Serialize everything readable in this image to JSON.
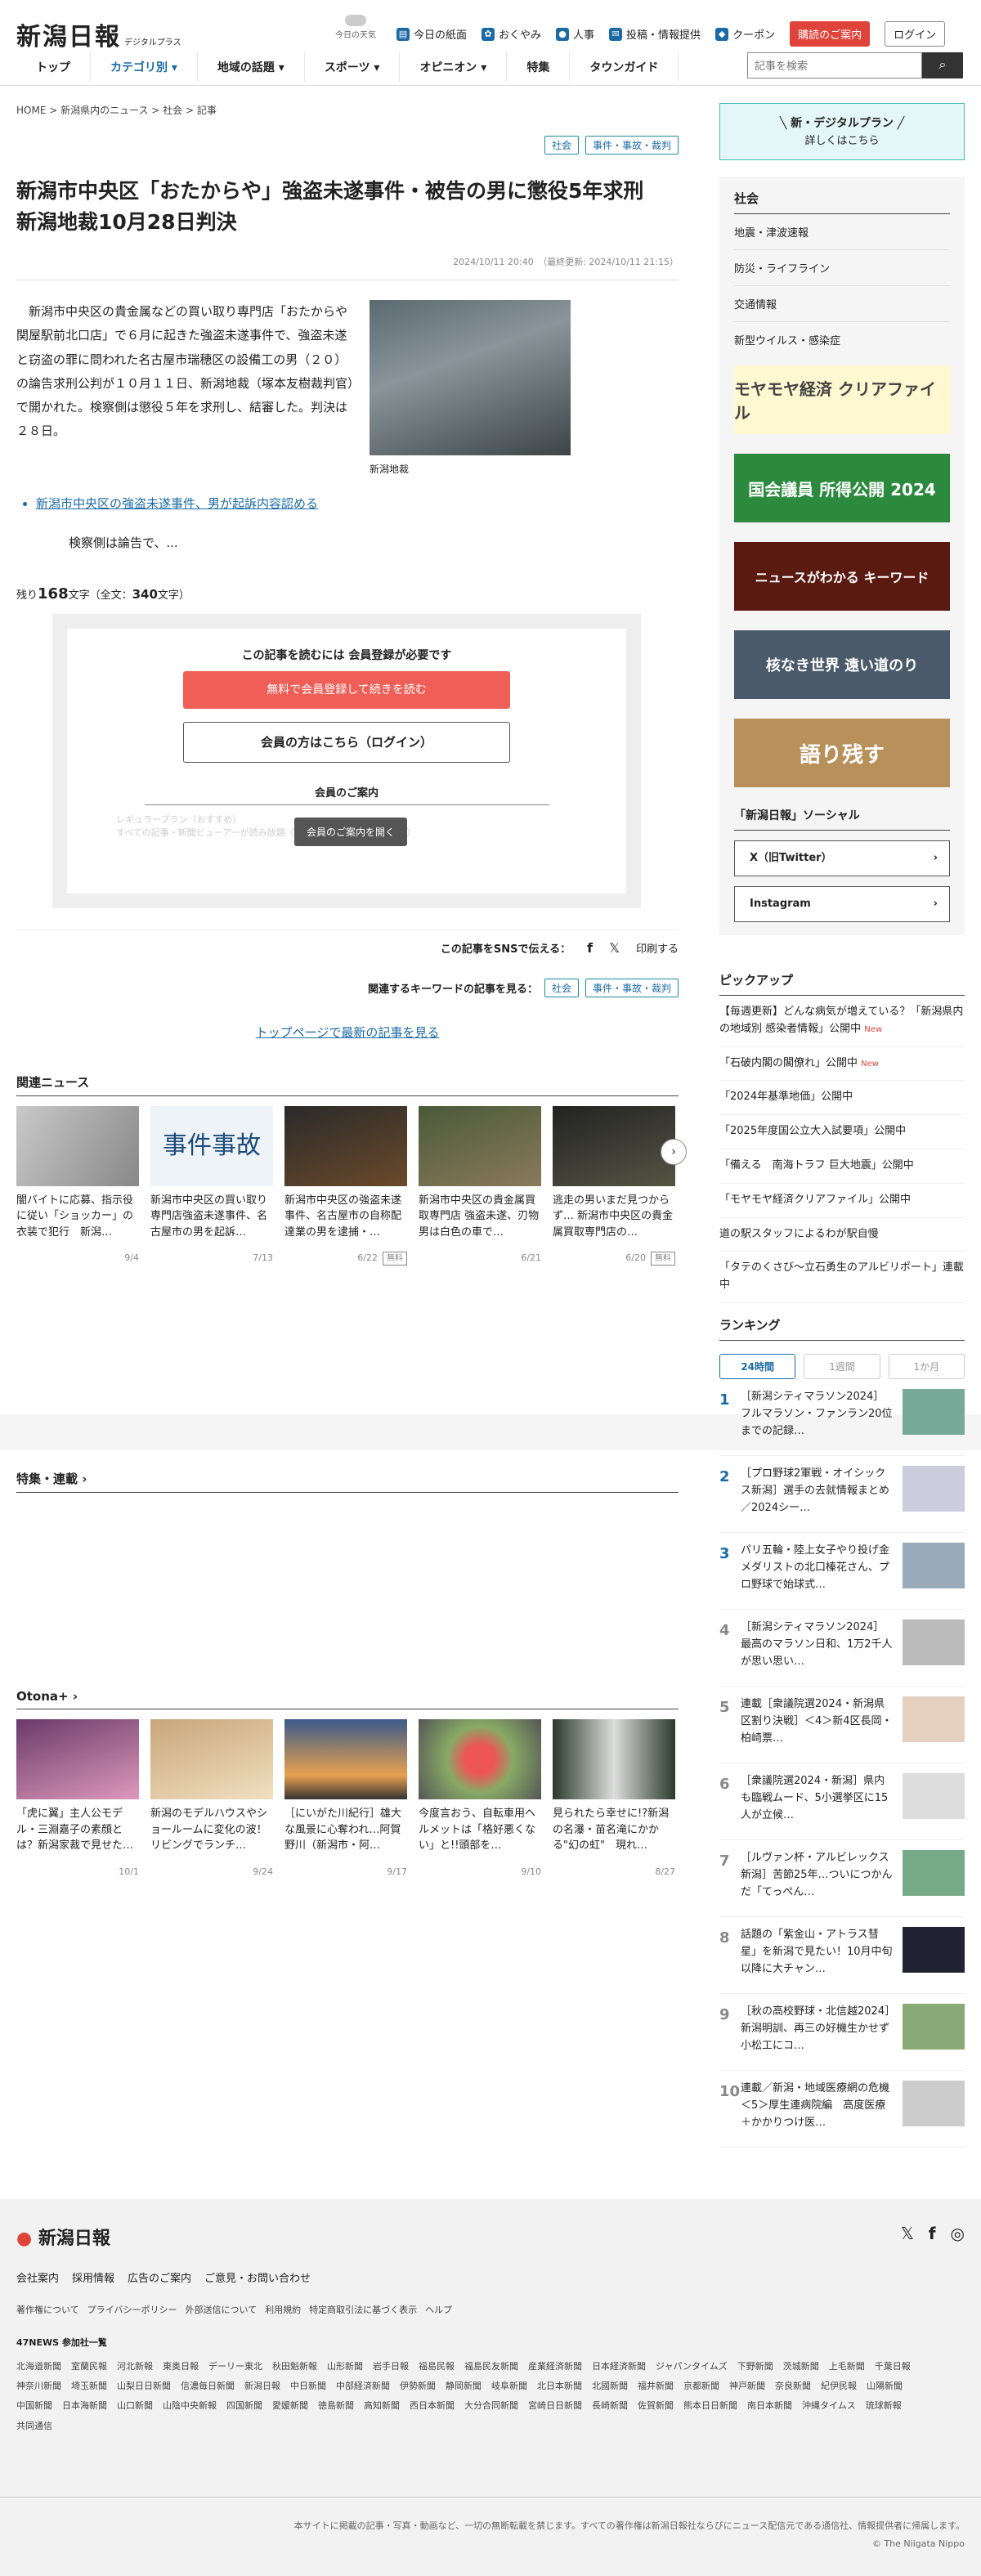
{
  "header": {
    "logo": "新潟日報",
    "logo_sub": "デジタルプラス",
    "weather": "今日の天気",
    "links": [
      "今日の紙面",
      "おくやみ",
      "人事",
      "投稿・情報提供",
      "クーポン"
    ],
    "subscribe": "購読のご案内",
    "login": "ログイン",
    "nav": [
      "トップ",
      "カテゴリ別 ▾",
      "地域の話題 ▾",
      "スポーツ ▾",
      "オピニオン ▾",
      "特集",
      "タウンガイド"
    ],
    "search_placeholder": "記事を検索"
  },
  "article": {
    "breadcrumb": "HOME > 新潟県内のニュース > 社会 > 記事",
    "tags": [
      "社会",
      "事件・事故・裁判"
    ],
    "title": "新潟市中央区「おたからや」強盗未遂事件・被告の男に懲役5年求刑　新潟地裁10月28日判決",
    "dates": "2024/10/11 20:40　（最終更新: 2024/10/11 21:15）",
    "body": "新潟市中央区の貴金属などの買い取り専門店「おたからや関屋駅前北口店」で６月に起きた強盗未遂事件で、強盗未遂と窃盗の罪に問われた名古屋市瑞穂区の設備工の男（２０）の論告求刑公判が１０月１１日、新潟地裁（塚本友樹裁判官）で開かれた。検察側は懲役５年を求刑し、結審した。判決は２８日。",
    "photo_caption": "新潟地裁",
    "related": "新潟市中央区の強盗未遂事件、男が起訴内容認める",
    "cont": "検察側は論告で、...",
    "remain_pre": "残り",
    "remain_num": "168",
    "remain_mid": "文字（全文：",
    "remain_total": "340",
    "remain_post": "文字）"
  },
  "paywall": {
    "title": "この記事を読むには 会員登録が必要です",
    "register": "無料で会員登録して続きを読む",
    "login": "会員の方はこちら（ログイン）",
    "guide": "会員のご案内",
    "regular": "レギュラープラン（おすすめ）",
    "all": "すべての記事・新聞ビューアーが読み放題（1日分は約400記事あります）",
    "open": "会員のご案内を開く"
  },
  "share": {
    "label": "この記事をSNSで伝える：",
    "print": "印刷する",
    "kw_label": "関連するキーワードの記事を見る：",
    "top": "トップページで最新の記事を見る"
  },
  "related_news": {
    "title": "関連ニュース",
    "items": [
      {
        "text": "闇バイトに応募、指示役に従い「ショッカー」の衣装で犯行　新潟…",
        "date": "9/4",
        "free": ""
      },
      {
        "text": "新潟市中央区の買い取り専門店強盗未遂事件、名古屋市の男を起訴…",
        "date": "7/13",
        "free": ""
      },
      {
        "text": "新潟市中央区の強盗未遂事件、名古屋市の自称配達業の男を逮捕・…",
        "date": "6/22",
        "free": "無料"
      },
      {
        "text": "新潟市中央区の貴金属買取専門店 強盗未遂、刃物男は白色の車で…",
        "date": "6/21",
        "free": ""
      },
      {
        "text": "逃走の男いまだ見つからず… 新潟市中央区の貴金属買取専門店の…",
        "date": "6/20",
        "free": "無料"
      }
    ]
  },
  "feature_title": "特集・連載",
  "otona": {
    "title": "Otona+",
    "items": [
      {
        "text": "「虎に翼」主人公モデル・三淵嘉子の素顔とは？新潟家裁で見せた…",
        "date": "10/1"
      },
      {
        "text": "新潟のモデルハウスやショールームに変化の波！リビングでランチ…",
        "date": "9/24"
      },
      {
        "text": "［にいがた川紀行］雄大な風景に心奪われ…阿賀野川（新潟市・阿…",
        "date": "9/17"
      },
      {
        "text": "今度言おう、自転車用ヘルメットは「格好悪くない」と!!頭部を…",
        "date": "9/10"
      },
      {
        "text": "見られたら幸せに!?新潟の名瀑・苗名滝にかかる\"幻の虹\"　現れ…",
        "date": "8/27"
      }
    ]
  },
  "sidebar": {
    "banner_title": "╲ 新・デジタルプラン ╱",
    "banner_sub": "詳しくはこちら",
    "cat_title": "社会",
    "cat_links": [
      "地震・津波速報",
      "防災・ライフライン",
      "交通情報",
      "新型ウイルス・感染症"
    ],
    "ads": [
      "モヤモヤ経済 クリアファイル",
      "国会議員 所得公開 2024",
      "ニュースがわかる キーワード",
      "核なき世界 遠い道のり",
      "語り残す"
    ],
    "social_title": "「新潟日報」ソーシャル",
    "social": [
      "X（旧Twitter）",
      "Instagram"
    ],
    "pickup_title": "ピックアップ",
    "new": "New",
    "pickup": [
      {
        "t": "【毎週更新】どんな病気が増えている？「新潟県内の地域別 感染者情報」公開中",
        "n": true
      },
      {
        "t": "「石破内閣の閣僚れ」公開中",
        "n": true
      },
      {
        "t": "「2024年基準地価」公開中",
        "n": false
      },
      {
        "t": "「2025年度国公立大入試要項」公開中",
        "n": false
      },
      {
        "t": "「備える　南海トラフ 巨大地震」公開中",
        "n": false
      },
      {
        "t": "「モヤモヤ経済クリアファイル」公開中",
        "n": false
      },
      {
        "t": "道の駅スタッフによるわが駅自慢",
        "n": false
      },
      {
        "t": "「タテのくさび〜立石勇生のアルビリポート」連載中",
        "n": false
      }
    ],
    "ranking_title": "ランキング",
    "ranking_tabs": [
      "24時間",
      "1週間",
      "1か月"
    ],
    "ranking": [
      {
        "n": "1",
        "t": "［新潟シティマラソン2024］フルマラソン・ファンラン20位までの記録…"
      },
      {
        "n": "2",
        "t": "［プロ野球2軍戦・オイシックス新潟］選手の去就情報まとめ／2024シー…"
      },
      {
        "n": "3",
        "t": "パリ五輪・陸上女子やり投げ金メダリストの北口榛花さん、プロ野球で始球式…"
      },
      {
        "n": "4",
        "t": "［新潟シティマラソン2024］最高のマラソン日和、1万2千人が思い思い…"
      },
      {
        "n": "5",
        "t": "連載［衆議院選2024・新潟県区割り決戦］＜4＞新4区長岡・柏崎票…"
      },
      {
        "n": "6",
        "t": "［衆議院選2024・新潟］県内も臨戦ムード、5小選挙区に15人が立候…"
      },
      {
        "n": "7",
        "t": "［ルヴァン杯・アルビレックス新潟］苦節25年…ついにつかんだ「てっぺん…"
      },
      {
        "n": "8",
        "t": "話題の「紫金山・アトラス彗星」を新潟で見たい！10月中旬以降に大チャン…"
      },
      {
        "n": "9",
        "t": "［秋の高校野球・北信越2024］新潟明訓、再三の好機生かせず小松工にコ…"
      },
      {
        "n": "10",
        "t": "連載／新潟・地域医療網の危機＜5＞厚生連病院編　高度医療＋かかりつけ医…"
      }
    ]
  },
  "footer": {
    "logo": "新潟日報",
    "links1": [
      "会社案内",
      "採用情報",
      "広告のご案内",
      "ご意見・お問い合わせ"
    ],
    "links2": [
      "著作権について",
      "プライバシーポリシー",
      "外部送信について",
      "利用規約",
      "特定商取引法に基づく表示",
      "ヘルプ"
    ],
    "np_title": "47NEWS 参加社一覧",
    "papers": [
      "北海道新聞",
      "室蘭民報",
      "河北新報",
      "東奥日報",
      "デーリー東北",
      "秋田魁新報",
      "山形新聞",
      "岩手日報",
      "福島民報",
      "福島民友新聞",
      "産業経済新聞",
      "日本経済新聞",
      "ジャパンタイムズ",
      "下野新聞",
      "茨城新聞",
      "上毛新聞",
      "千葉日報",
      "神奈川新聞",
      "埼玉新聞",
      "山梨日日新聞",
      "信濃毎日新聞",
      "新潟日報",
      "中日新聞",
      "中部経済新聞",
      "伊勢新聞",
      "静岡新聞",
      "岐阜新聞",
      "北日本新聞",
      "北國新聞",
      "福井新聞",
      "京都新聞",
      "神戸新聞",
      "奈良新聞",
      "紀伊民報",
      "山陽新聞",
      "中国新聞",
      "日本海新聞",
      "山口新聞",
      "山陰中央新報",
      "四国新聞",
      "愛媛新聞",
      "徳島新聞",
      "高知新聞",
      "西日本新聞",
      "大分合同新聞",
      "宮崎日日新聞",
      "長崎新聞",
      "佐賀新聞",
      "熊本日日新聞",
      "南日本新聞",
      "沖縄タイムス",
      "琉球新報",
      "共同通信"
    ],
    "copy1": "本サイトに掲載の記事・写真・動画など、一切の無断転載を禁じます。すべての著作権は新潟日報社ならびにニュース配信元である通信社、情報提供者に帰属します。",
    "copy2": "© The Niigata Nippo"
  }
}
